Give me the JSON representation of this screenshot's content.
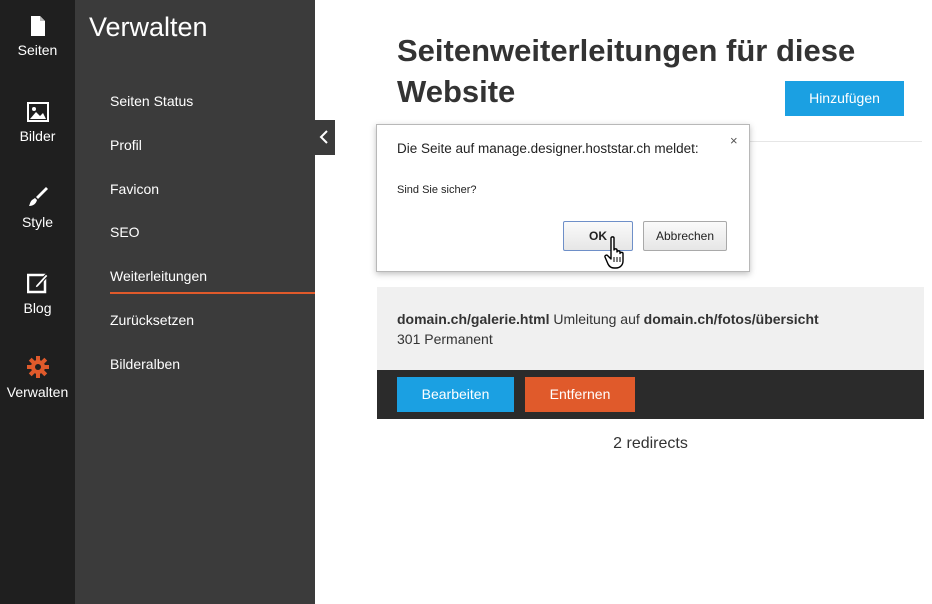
{
  "rail": {
    "items": [
      {
        "label": "Seiten",
        "icon": "page-icon"
      },
      {
        "label": "Bilder",
        "icon": "image-icon"
      },
      {
        "label": "Style",
        "icon": "brush-icon"
      },
      {
        "label": "Blog",
        "icon": "edit-icon"
      },
      {
        "label": "Verwalten",
        "icon": "gear-icon"
      }
    ],
    "active_color": "#e05a2b"
  },
  "panel": {
    "title": "Verwalten",
    "items": [
      {
        "label": "Seiten Status"
      },
      {
        "label": "Profil"
      },
      {
        "label": "Favicon"
      },
      {
        "label": "SEO"
      },
      {
        "label": "Weiterleitungen"
      },
      {
        "label": "Zurücksetzen"
      },
      {
        "label": "Bilderalben"
      }
    ]
  },
  "main": {
    "title": "Seitenweiterleitungen für diese Website",
    "add_label": "Hinzufügen",
    "redirect": {
      "from": "domain.ch/galerie.html",
      "middle": " Umleitung auf ",
      "to": "domain.ch/fotos/übersicht",
      "type": "301 Permanent"
    },
    "edit_label": "Bearbeiten",
    "remove_label": "Entfernen",
    "count_text": "2 redirects"
  },
  "dialog": {
    "message": "Die Seite auf manage.designer.hoststar.ch meldet:",
    "question": "Sind Sie sicher?",
    "ok_label": "OK",
    "cancel_label": "Abbrechen",
    "close_glyph": "×"
  },
  "colors": {
    "blue": "#1ba0e2",
    "orange": "#e05a2b",
    "rail_bg": "#1f1f1f",
    "panel_bg": "#3b3b3b"
  }
}
